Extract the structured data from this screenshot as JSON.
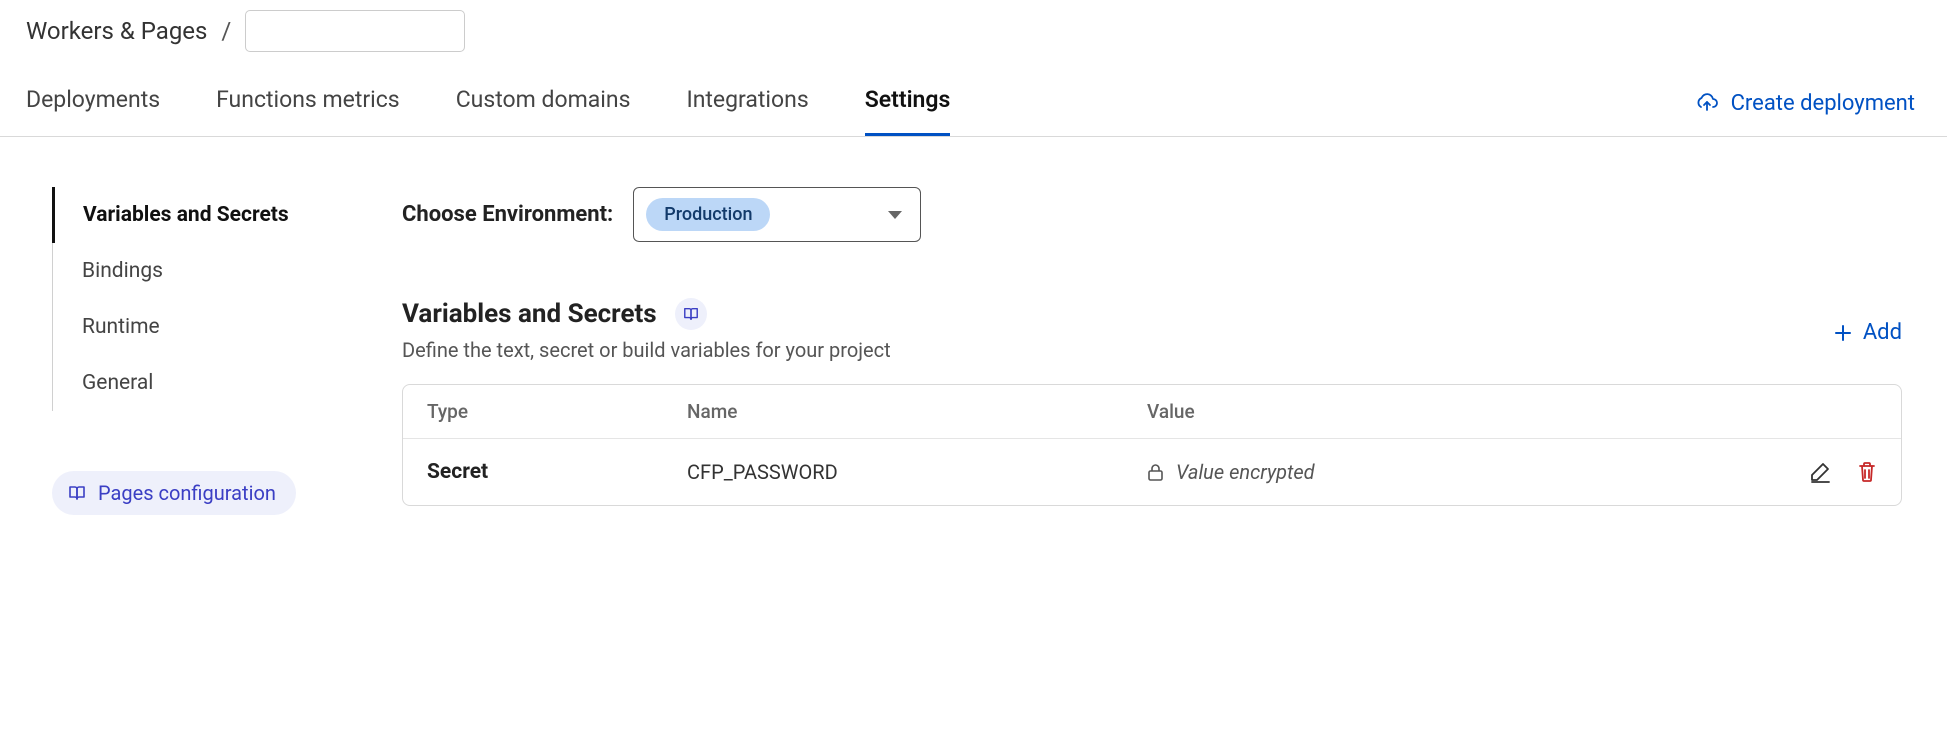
{
  "breadcrumb": {
    "root": "Workers & Pages"
  },
  "tabs": [
    {
      "label": "Deployments",
      "active": false
    },
    {
      "label": "Functions metrics",
      "active": false
    },
    {
      "label": "Custom domains",
      "active": false
    },
    {
      "label": "Integrations",
      "active": false
    },
    {
      "label": "Settings",
      "active": true
    }
  ],
  "header_action": {
    "create_deployment_label": "Create deployment"
  },
  "sidebar": {
    "items": [
      {
        "label": "Variables and Secrets",
        "active": true
      },
      {
        "label": "Bindings",
        "active": false
      },
      {
        "label": "Runtime",
        "active": false
      },
      {
        "label": "General",
        "active": false
      }
    ],
    "pages_config_label": "Pages configuration"
  },
  "environment": {
    "label": "Choose Environment:",
    "selected": "Production"
  },
  "section": {
    "title": "Variables and Secrets",
    "description": "Define the text, secret or build variables for your project",
    "add_label": "Add"
  },
  "table": {
    "headers": {
      "type": "Type",
      "name": "Name",
      "value": "Value"
    },
    "rows": [
      {
        "type": "Secret",
        "name": "CFP_PASSWORD",
        "value": "Value encrypted",
        "encrypted": true
      }
    ]
  }
}
